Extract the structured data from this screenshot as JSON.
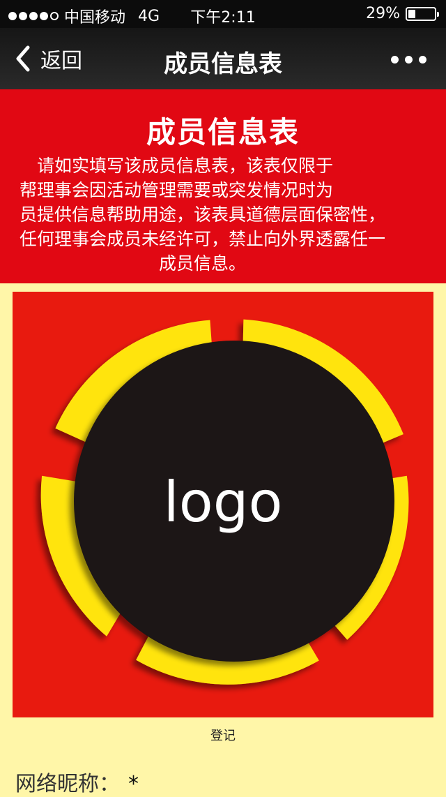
{
  "status_bar": {
    "carrier": "中国移动",
    "network": "4G",
    "time": "下午2:11",
    "battery": "29%",
    "battery_level": 0.29,
    "signal_bars": 4
  },
  "nav": {
    "back_label": "返回",
    "title": "成员信息表",
    "more_icon": "more-dots-icon"
  },
  "banner": {
    "title": "成员信息表",
    "text": "　请如实填写该成员信息表，该表仅限于\n帮理事会因活动管理需要或突发情况时为\n员提供信息帮助用途，该表具道德层面保密性，\n任何理事会成员未经许可，禁止向外界透露任一\n　　　　　　　　成员信息。"
  },
  "logo": {
    "text": "logo",
    "colors": {
      "background": "#E81A0F",
      "ring": "#FFE411",
      "circle": "#1C1414"
    }
  },
  "caption": "登记",
  "form": {
    "nickname_label": "网络昵称：",
    "required_mark": "*"
  }
}
